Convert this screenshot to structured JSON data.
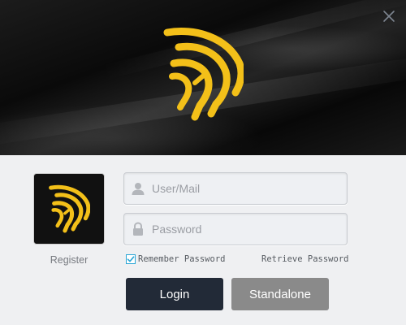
{
  "window": {
    "close_icon": "close-icon",
    "brand_logo_icon": "helmet-logo-icon"
  },
  "colors": {
    "logo_yellow": "#f3c019",
    "login_button": "#222a37",
    "standalone_button": "#8a8a8a",
    "checkbox_accent": "#2aa6d6"
  },
  "account": {
    "register_label": "Register"
  },
  "form": {
    "user_placeholder": "User/Mail",
    "user_value": "",
    "user_icon": "user-icon",
    "password_placeholder": "Password",
    "password_value": "",
    "password_icon": "lock-icon",
    "remember_label": "Remember Password",
    "remember_checked": true,
    "retrieve_label": "Retrieve Password"
  },
  "buttons": {
    "login_label": "Login",
    "standalone_label": "Standalone"
  }
}
